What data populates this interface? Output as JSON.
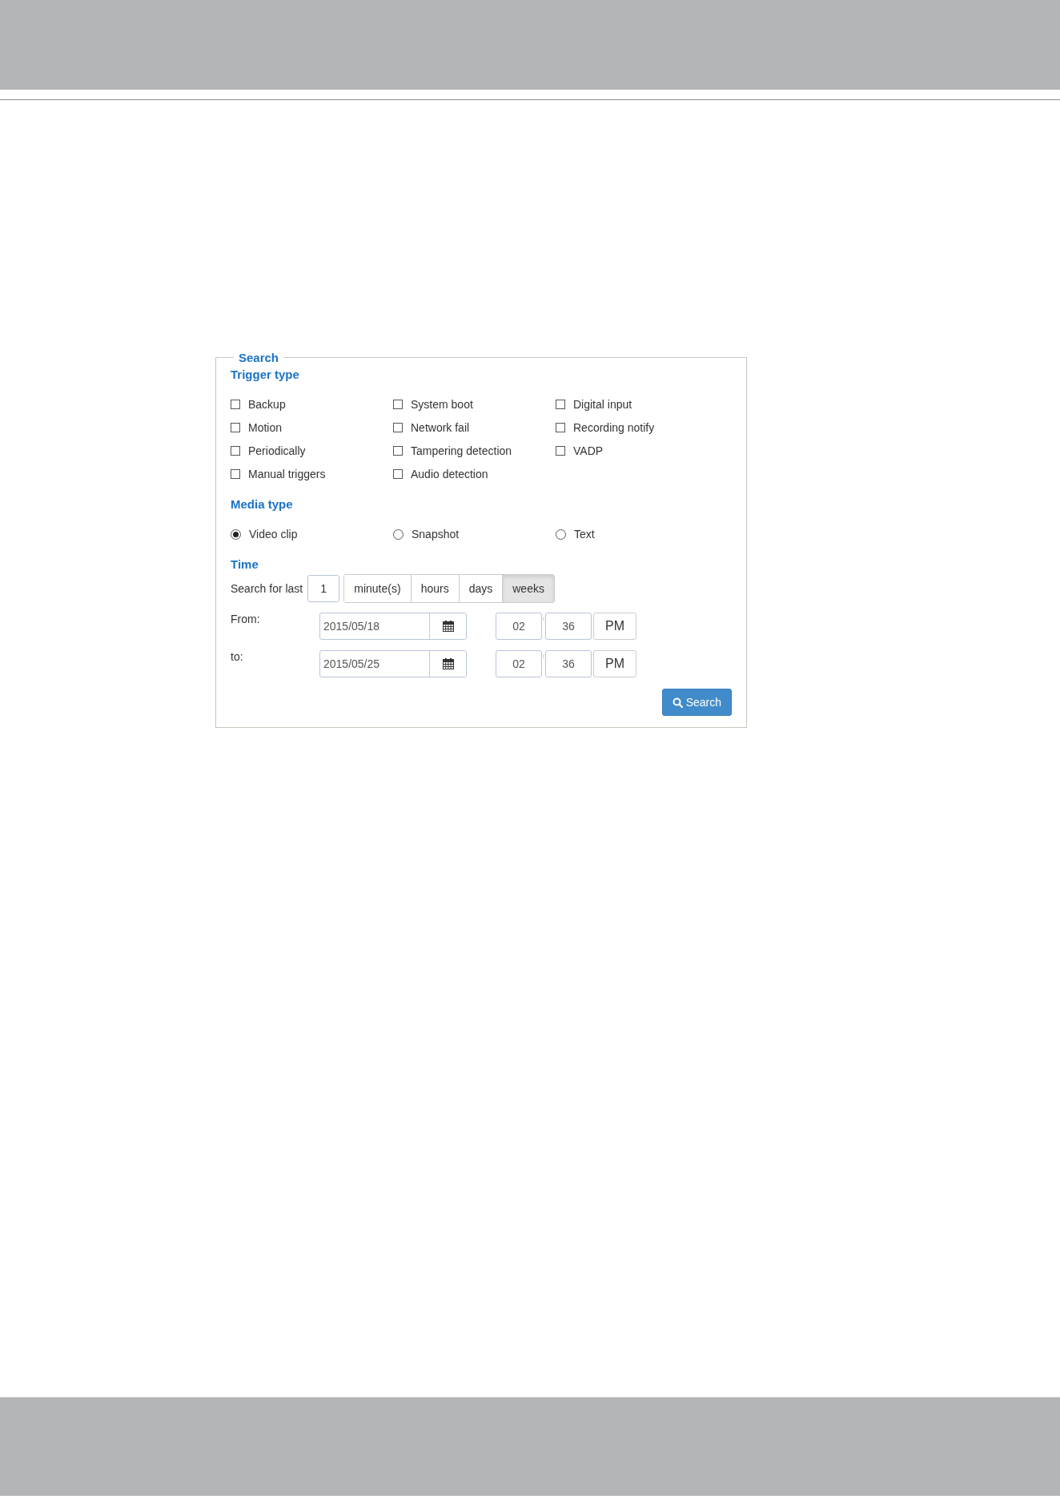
{
  "search_panel": {
    "title": "Search",
    "trigger_type": {
      "heading": "Trigger type",
      "options": [
        {
          "label": "Backup",
          "checked": false
        },
        {
          "label": "System boot",
          "checked": false
        },
        {
          "label": "Digital input",
          "checked": false
        },
        {
          "label": "Motion",
          "checked": false
        },
        {
          "label": "Network fail",
          "checked": false
        },
        {
          "label": "Recording notify",
          "checked": false
        },
        {
          "label": "Periodically",
          "checked": false
        },
        {
          "label": "Tampering detection",
          "checked": false
        },
        {
          "label": "VADP",
          "checked": false
        },
        {
          "label": "Manual triggers",
          "checked": false
        },
        {
          "label": "Audio detection",
          "checked": false
        }
      ]
    },
    "media_type": {
      "heading": "Media type",
      "options": [
        {
          "label": "Video clip",
          "selected": true
        },
        {
          "label": "Snapshot",
          "selected": false
        },
        {
          "label": "Text",
          "selected": false
        }
      ]
    },
    "time": {
      "heading": "Time",
      "search_for_last": {
        "label": "Search for last",
        "value": "1",
        "units": [
          {
            "label": "minute(s)",
            "selected": false
          },
          {
            "label": "hours",
            "selected": false
          },
          {
            "label": "days",
            "selected": false
          },
          {
            "label": "weeks",
            "selected": true
          }
        ]
      },
      "ranges": [
        {
          "label": "From:",
          "date": "2015/05/18",
          "hour": "02",
          "minute": "36",
          "ampm": "PM"
        },
        {
          "label": "to:",
          "date": "2015/05/25",
          "hour": "02",
          "minute": "36",
          "ampm": "PM"
        }
      ]
    },
    "search_button": "Search"
  }
}
